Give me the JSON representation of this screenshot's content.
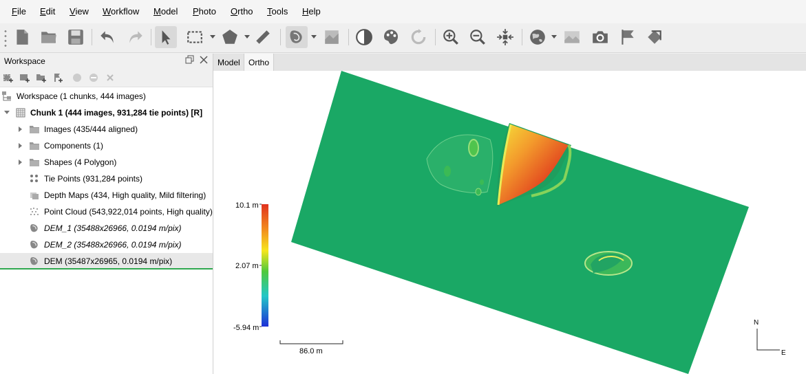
{
  "menu": [
    "File",
    "Edit",
    "View",
    "Workflow",
    "Model",
    "Photo",
    "Ortho",
    "Tools",
    "Help"
  ],
  "toolbar_icons": [
    "new-icon",
    "open-icon",
    "save-icon",
    "undo-icon",
    "redo-icon",
    "navigation-icon",
    "rect-select-icon",
    "polygon-draw-icon",
    "ruler-icon",
    "dem-icon",
    "orthomosaic-icon",
    "contrast-icon",
    "palette-icon",
    "refresh-icon",
    "zoom-in-icon",
    "zoom-out-icon",
    "fit-view-icon",
    "globe-icon",
    "image-view-icon",
    "camera-icon",
    "marker-flag-icon",
    "seamline-icon"
  ],
  "workspace": {
    "title": "Workspace",
    "root_label": "Workspace (1 chunks, 444 images)",
    "chunk_label": "Chunk 1 (444 images, 931,284 tie points) [R]",
    "items": [
      {
        "label": "Images (435/444 aligned)",
        "icon": "folder-icon",
        "expandable": true,
        "italic": false
      },
      {
        "label": "Components (1)",
        "icon": "folder-icon",
        "expandable": true,
        "italic": false
      },
      {
        "label": "Shapes (4 Polygon)",
        "icon": "folder-icon",
        "expandable": true,
        "italic": false
      },
      {
        "label": "Tie Points (931,284 points)",
        "icon": "tie-points-icon",
        "expandable": false,
        "italic": false
      },
      {
        "label": "Depth Maps (434, High quality, Mild filtering)",
        "icon": "depth-maps-icon",
        "expandable": false,
        "italic": false
      },
      {
        "label": "Point Cloud (543,922,014 points, High quality)",
        "icon": "point-cloud-icon",
        "expandable": false,
        "italic": false
      },
      {
        "label": "DEM_1 (35488x26966, 0.0194 m/pix)",
        "icon": "dem-icon",
        "expandable": false,
        "italic": true
      },
      {
        "label": "DEM_2 (35488x26966, 0.0194 m/pix)",
        "icon": "dem-icon",
        "expandable": false,
        "italic": true
      },
      {
        "label": "DEM (35487x26965, 0.0194 m/pix)",
        "icon": "dem-icon",
        "expandable": false,
        "italic": false,
        "selected": true
      }
    ]
  },
  "tabs": [
    "Model",
    "Ortho"
  ],
  "active_tab": "Ortho",
  "legend": {
    "max": "10.1 m",
    "mid": "2.07 m",
    "min": "-5.94 m"
  },
  "scale_bar": "86.0 m",
  "compass": {
    "north": "N",
    "east": "E"
  },
  "colors": {
    "terrain": "#1aa865",
    "selection": "#2fa84f"
  }
}
